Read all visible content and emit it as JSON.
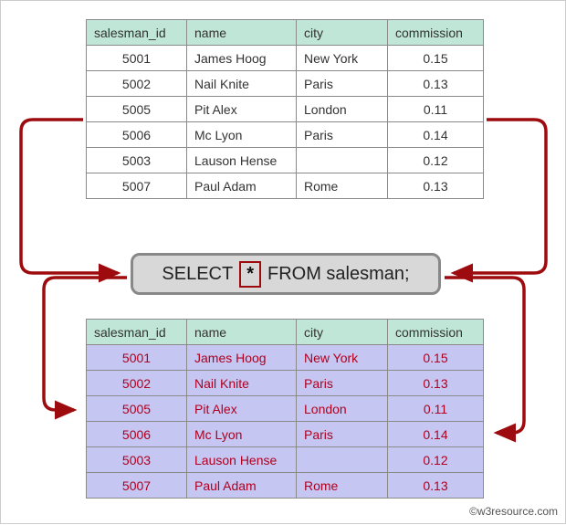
{
  "columns": {
    "salesman_id": "salesman_id",
    "name": "name",
    "city": "city",
    "commission": "commission"
  },
  "source_rows": [
    {
      "id": "5001",
      "name": "James Hoog",
      "city": "New York",
      "commission": "0.15"
    },
    {
      "id": "5002",
      "name": "Nail Knite",
      "city": "Paris",
      "commission": "0.13"
    },
    {
      "id": "5005",
      "name": "Pit Alex",
      "city": "London",
      "commission": "0.11"
    },
    {
      "id": "5006",
      "name": "Mc Lyon",
      "city": "Paris",
      "commission": "0.14"
    },
    {
      "id": "5003",
      "name": "Lauson Hense",
      "city": "",
      "commission": "0.12"
    },
    {
      "id": "5007",
      "name": "Paul Adam",
      "city": "Rome",
      "commission": "0.13"
    }
  ],
  "result_rows": [
    {
      "id": "5001",
      "name": "James Hoog",
      "city": "New York",
      "commission": "0.15"
    },
    {
      "id": "5002",
      "name": "Nail Knite",
      "city": "Paris",
      "commission": "0.13"
    },
    {
      "id": "5005",
      "name": "Pit Alex",
      "city": "London",
      "commission": "0.11"
    },
    {
      "id": "5006",
      "name": "Mc Lyon",
      "city": "Paris",
      "commission": "0.14"
    },
    {
      "id": "5003",
      "name": "Lauson Hense",
      "city": "",
      "commission": "0.12"
    },
    {
      "id": "5007",
      "name": "Paul Adam",
      "city": "Rome",
      "commission": "0.13"
    }
  ],
  "query": {
    "select": "SELECT",
    "star": "*",
    "from": "FROM salesman;"
  },
  "credit": "©w3resource.com"
}
